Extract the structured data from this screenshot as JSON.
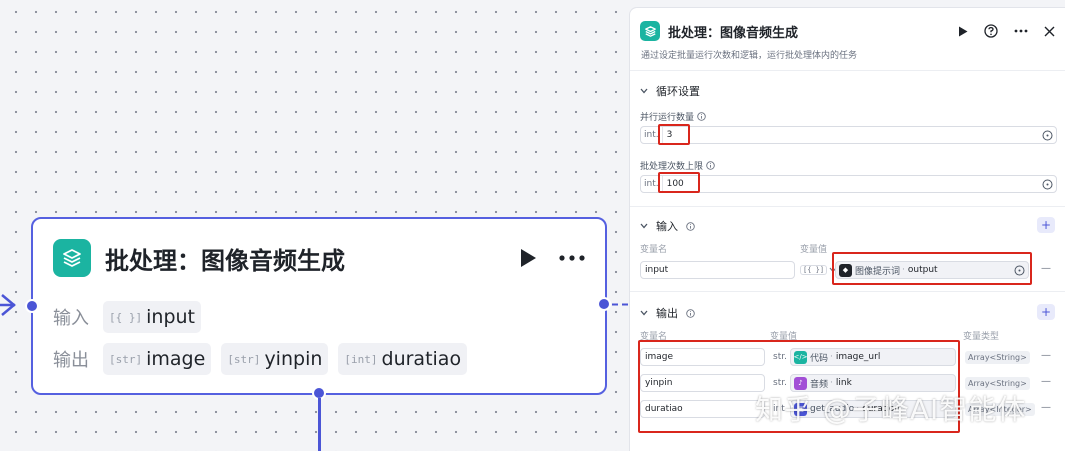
{
  "node": {
    "title": "批处理：图像音频生成",
    "input_label": "输入",
    "output_label": "输出",
    "inputs": [
      {
        "type": "[{ }]",
        "name": "input"
      }
    ],
    "outputs": [
      {
        "type": "[str]",
        "name": "image"
      },
      {
        "type": "[str]",
        "name": "yinpin"
      },
      {
        "type": "[int]",
        "name": "duratiao"
      }
    ]
  },
  "panel": {
    "title": "批处理：图像音频生成",
    "description": "通过设定批量运行次数和逻辑，运行批处理体内的任务",
    "loop_section": {
      "title": "循环设置",
      "parallel_label": "并行运行数量",
      "parallel_type": "int.",
      "parallel_value": "3",
      "limit_label": "批处理次数上限",
      "limit_type": "int.",
      "limit_value": "100"
    },
    "input_section": {
      "title": "输入",
      "col_name": "变量名",
      "col_value": "变量值",
      "rows": [
        {
          "name": "input",
          "type": "[{ }]",
          "ref_node": "图像提示词",
          "ref_var": "output"
        }
      ]
    },
    "output_section": {
      "title": "输出",
      "col_name": "变量名",
      "col_value": "变量值",
      "col_type": "变量类型",
      "rows": [
        {
          "name": "image",
          "type": "str.",
          "ref_node": "代码",
          "ref_var": "image_url",
          "var_type": "Array<String>"
        },
        {
          "name": "yinpin",
          "type": "str.",
          "ref_node": "音频",
          "ref_var": "link",
          "var_type": "Array<String>"
        },
        {
          "name": "duratiao",
          "type": "int.",
          "ref_node": "get_audio",
          "ref_var": "duration",
          "var_type": "Array<Integer>"
        }
      ]
    }
  },
  "watermark": "知乎 @子峰AI智能体",
  "colors": {
    "accent": "#4b55d6",
    "logo": "#1bb4a1",
    "highlight": "#d9261c"
  }
}
